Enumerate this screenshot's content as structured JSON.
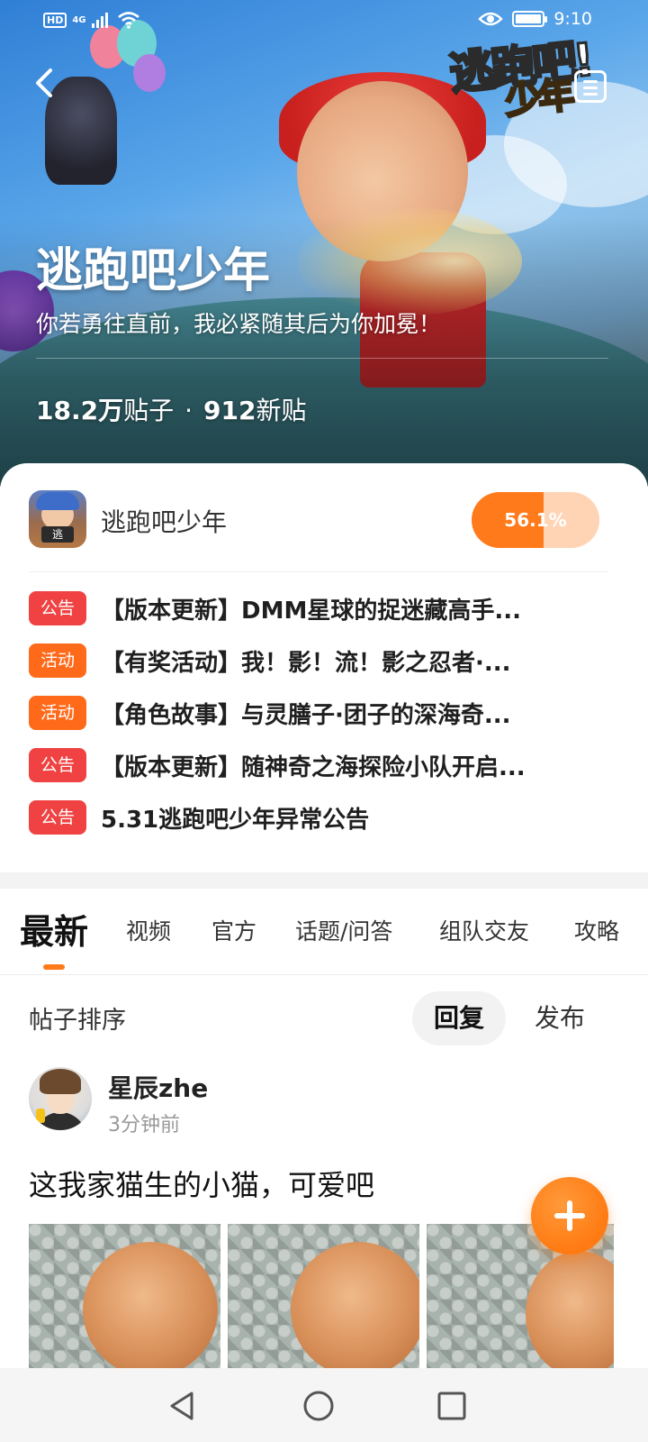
{
  "status_bar": {
    "hd": "HD",
    "network": "4G",
    "time": "9:10",
    "icons": [
      "signal-icon",
      "wifi-icon",
      "eye-icon",
      "battery-icon"
    ]
  },
  "hero": {
    "logo_line1": "逃跑吧!",
    "logo_line2": "少年",
    "title": "逃跑吧少年",
    "subtitle": "你若勇往直前，我必紧随其后为你加冕！",
    "posts_count": "18.2万",
    "posts_label": "贴子",
    "separator": "·",
    "new_count": "912",
    "new_label": "新贴"
  },
  "game": {
    "icon_tag": "逃",
    "name": "逃跑吧少年",
    "progress_text": "56.1%",
    "progress_value": 56.1
  },
  "notices": [
    {
      "badge": "公告",
      "color": "#f04242",
      "text": "【版本更新】DMM星球的捉迷藏高手..."
    },
    {
      "badge": "活动",
      "color": "#ff6a1a",
      "text": "【有奖活动】我！影！流！影之忍者·..."
    },
    {
      "badge": "活动",
      "color": "#ff6a1a",
      "text": "【角色故事】与灵膳子·团子的深海奇..."
    },
    {
      "badge": "公告",
      "color": "#f04242",
      "text": "【版本更新】随神奇之海探险小队开启..."
    },
    {
      "badge": "公告",
      "color": "#f04242",
      "text": "5.31逃跑吧少年异常公告"
    }
  ],
  "tabs": [
    "最新",
    "视频",
    "官方",
    "话题/问答",
    "组队交友",
    "攻略"
  ],
  "active_tab": 0,
  "sort": {
    "label": "帖子排序",
    "options": [
      "回复",
      "发布"
    ],
    "active": 0
  },
  "post": {
    "author": "星辰zhe",
    "time": "3分钟前",
    "text": "这我家猫生的小猫，可爱吧"
  },
  "colors": {
    "accent": "#ff7a1a",
    "notice_red": "#f04242",
    "notice_orange": "#ff6a1a"
  }
}
